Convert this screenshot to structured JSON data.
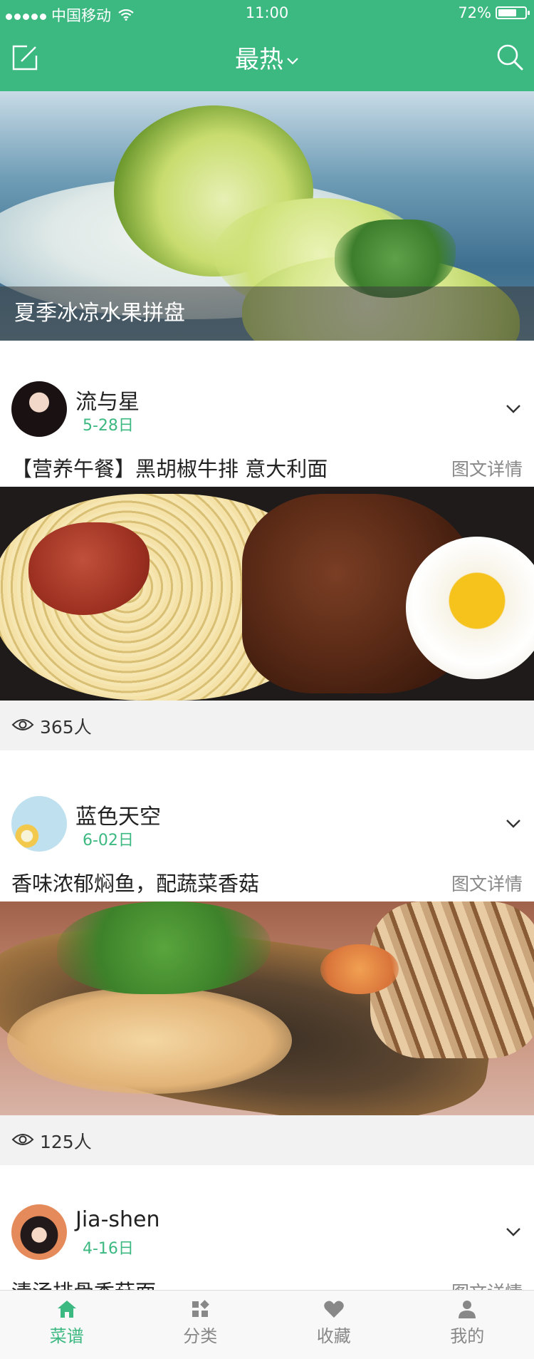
{
  "status": {
    "carrier": "中国移动",
    "time": "11:00",
    "battery": "72%",
    "battery_level": 0.72
  },
  "nav": {
    "title": "最热",
    "edit_icon": "edit-icon",
    "search_icon": "search-icon",
    "accent_color": "#3cb881"
  },
  "hero": {
    "caption": "夏季冰凉水果拼盘"
  },
  "posts": [
    {
      "author": "流与星",
      "date": "5-28日",
      "title": "【营养午餐】黑胡椒牛排 意大利面",
      "detail_link": "图文详情",
      "views": "365人"
    },
    {
      "author": "蓝色天空",
      "date": "6-02日",
      "title": "香味浓郁焖鱼，配蔬菜香菇",
      "detail_link": "图文详情",
      "views": "125人"
    },
    {
      "author": "Jia-shen",
      "date": "4-16日",
      "title": "清汤排骨香菇面",
      "detail_link": "图文详情"
    }
  ],
  "tabbar": {
    "items": [
      {
        "label": "菜谱",
        "icon": "home-icon",
        "active": true
      },
      {
        "label": "分类",
        "icon": "category-icon",
        "active": false
      },
      {
        "label": "收藏",
        "icon": "heart-icon",
        "active": false
      },
      {
        "label": "我的",
        "icon": "user-icon",
        "active": false
      }
    ]
  }
}
